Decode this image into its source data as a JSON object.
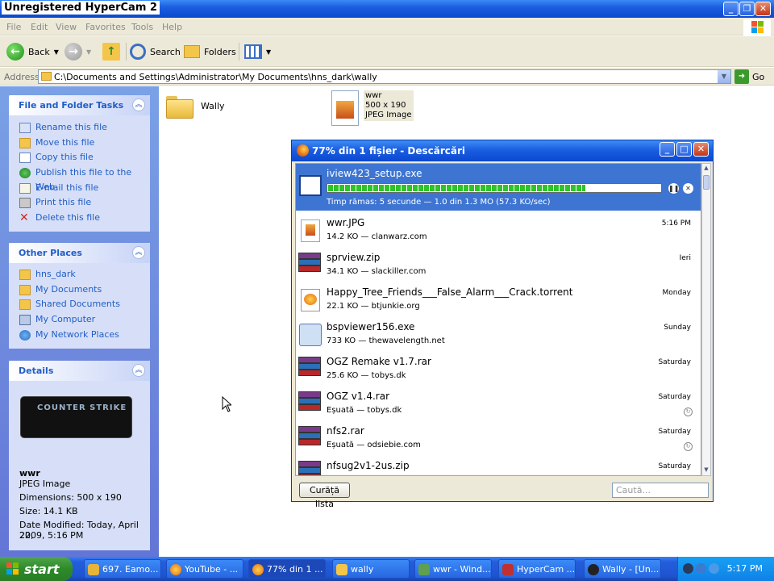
{
  "window": {
    "title": "Unregistered HyperCam 2",
    "controls": [
      "_",
      "❐",
      "✕"
    ]
  },
  "menu": [
    "File",
    "Edit",
    "View",
    "Favorites",
    "Tools",
    "Help"
  ],
  "toolbar": {
    "back": "Back",
    "search": "Search",
    "folders": "Folders"
  },
  "address": {
    "label": "Address",
    "path": "C:\\Documents and Settings\\Administrator\\My Documents\\hns_dark\\wally",
    "go": "Go"
  },
  "left": {
    "file_tasks": {
      "title": "File and Folder Tasks",
      "items": [
        "Rename this file",
        "Move this file",
        "Copy this file",
        "Publish this file to the Web",
        "E-mail this file",
        "Print this file",
        "Delete this file"
      ]
    },
    "other_places": {
      "title": "Other Places",
      "items": [
        "hns_dark",
        "My Documents",
        "Shared Documents",
        "My Computer",
        "My Network Places"
      ]
    },
    "details": {
      "title": "Details",
      "name": "wwr",
      "type": "JPEG Image",
      "dimensions": "Dimensions: 500 x 190",
      "size": "Size: 14.1 KB",
      "modified_1": "Date Modified: Today, April 22,",
      "modified_2": "2009, 5:16 PM",
      "thumb_text": "COUNTER STRIKE"
    }
  },
  "main": {
    "folder_name": "Wally",
    "file_name": "wwr",
    "file_dims": "500 x 190",
    "file_type": "JPEG Image"
  },
  "downloads": {
    "title": "77% din 1 fișier - Descărcări",
    "active": {
      "name": "iview423_setup.exe",
      "status": "Timp rămas: 5 secunde — 1.0 din 1.3 MO (57.3 KO/sec)",
      "progress": 0.77
    },
    "items": [
      {
        "name": "wwr.JPG",
        "meta": "14.2 KO — clanwarz.com",
        "date": "5:16 PM"
      },
      {
        "name": "sprview.zip",
        "meta": "34.1 KO — slackiller.com",
        "date": "Ieri"
      },
      {
        "name": "Happy_Tree_Friends___False_Alarm___Crack.torrent",
        "meta": "22.1 KO — btjunkie.org",
        "date": "Monday"
      },
      {
        "name": "bspviewer156.exe",
        "meta": "733 KO — thewavelength.net",
        "date": "Sunday"
      },
      {
        "name": "OGZ Remake v1.7.rar",
        "meta": "25.6 KO — tobys.dk",
        "date": "Saturday"
      },
      {
        "name": "OGZ v1.4.rar",
        "meta": "Eșuată — tobys.dk",
        "date": "Saturday"
      },
      {
        "name": "nfs2.rar",
        "meta": "Eșuată — odsiebie.com",
        "date": "Saturday"
      },
      {
        "name": "nfsug2v1-2us.zip",
        "meta": "",
        "date": "Saturday"
      }
    ],
    "clear_button": "Curăță lista",
    "search_placeholder": "Caută..."
  },
  "taskbar": {
    "start": "start",
    "items": [
      "697. Eamo...",
      "YouTube - ...",
      "77% din 1 ...",
      "wally",
      "wwr - Wind...",
      "HyperCam ...",
      "Wally - [Un..."
    ],
    "time": "5:17 PM"
  }
}
